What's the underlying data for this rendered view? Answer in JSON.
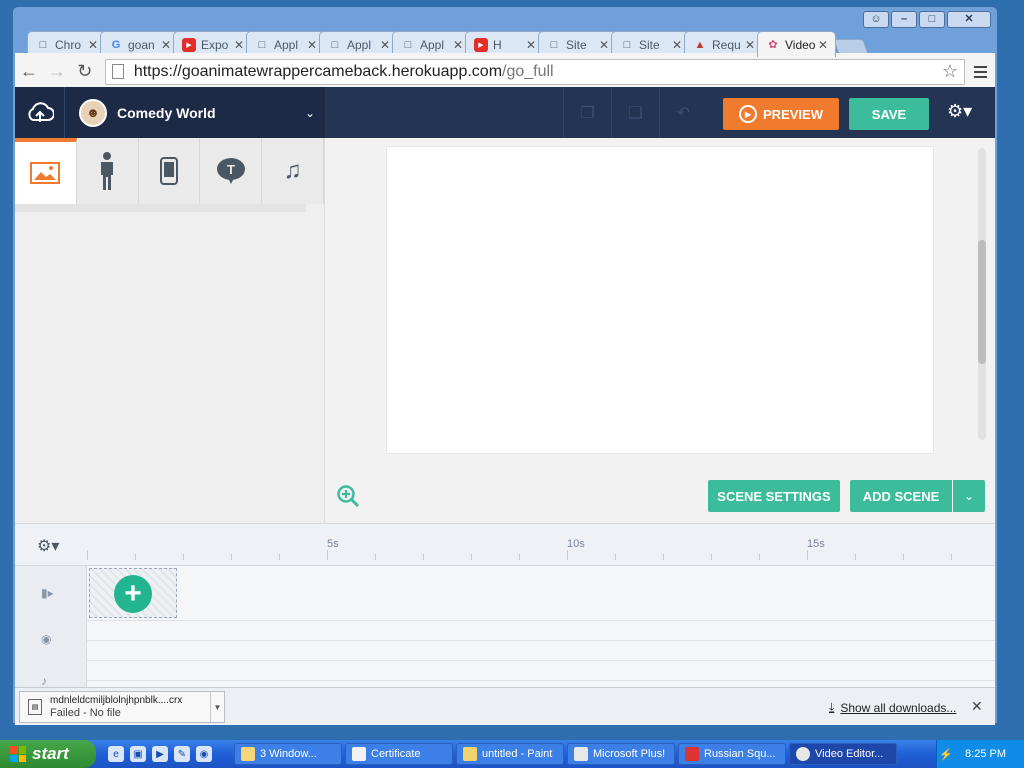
{
  "browser": {
    "tabs": [
      {
        "title": "Chro",
        "icon": "page-icon",
        "active": false
      },
      {
        "title": "goan",
        "icon": "google-icon",
        "active": false
      },
      {
        "title": "Expo",
        "icon": "youtube-icon",
        "active": false
      },
      {
        "title": "Appl",
        "icon": "page-icon",
        "active": false
      },
      {
        "title": "Appl",
        "icon": "page-icon",
        "active": false
      },
      {
        "title": "Appl",
        "icon": "page-icon",
        "active": false
      },
      {
        "title": "H",
        "icon": "youtube-icon",
        "active": false
      },
      {
        "title": "Site",
        "icon": "page-icon",
        "active": false
      },
      {
        "title": "Site",
        "icon": "page-icon",
        "active": false
      },
      {
        "title": "Requ",
        "icon": "image-icon",
        "active": false
      },
      {
        "title": "Video",
        "icon": "app-icon",
        "active": true
      }
    ],
    "url_host": "https://goanimatewrappercameback.herokuapp.com",
    "url_path": "/go_full"
  },
  "app": {
    "theme_name": "Comedy World",
    "preview_label": "PREVIEW",
    "save_label": "SAVE",
    "scene_settings_label": "SCENE SETTINGS",
    "add_scene_label": "ADD SCENE",
    "accent_orange": "#f07b2e",
    "accent_green": "#3dbc9b",
    "side_tabs": [
      "image-icon",
      "character-icon",
      "phone-icon",
      "text-bubble-icon",
      "music-icon"
    ],
    "timeline": {
      "ticks": [
        "5s",
        "10s",
        "15s"
      ]
    }
  },
  "downloads": {
    "file_name": "mdnleldcmiljblolnjhpnblk....crx",
    "status": "Failed - No file",
    "show_all": "Show all downloads..."
  },
  "taskbar": {
    "start_label": "start",
    "tasks": [
      {
        "label": "3 Window...",
        "active": false
      },
      {
        "label": "Certificate",
        "active": false
      },
      {
        "label": "untitled - Paint",
        "active": false
      },
      {
        "label": "Microsoft Plus!",
        "active": false
      },
      {
        "label": "Russian Squ...",
        "active": false
      },
      {
        "label": "Video Editor...",
        "active": true
      }
    ],
    "clock": "8:25 PM"
  }
}
